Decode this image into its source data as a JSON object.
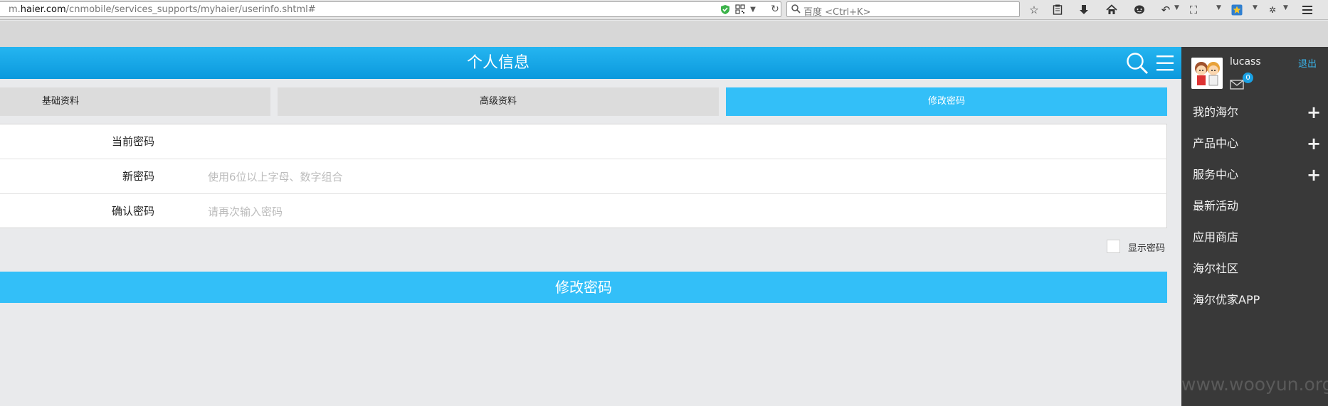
{
  "browser": {
    "url_prefix": "m.",
    "url_domain": "haier.com",
    "url_path": "/cnmobile/services_supports/myhaier/userinfo.shtml#",
    "search_placeholder": "百度 <Ctrl+K>"
  },
  "header": {
    "title": "个人信息"
  },
  "tabs": [
    {
      "label": "基础资料",
      "active": false
    },
    {
      "label": "高级资料",
      "active": false
    },
    {
      "label": "修改密码",
      "active": true
    }
  ],
  "form": {
    "current_password": {
      "label": "当前密码",
      "placeholder": ""
    },
    "new_password": {
      "label": "新密码",
      "placeholder": "使用6位以上字母、数字组合"
    },
    "confirm_password": {
      "label": "确认密码",
      "placeholder": "请再次输入密码"
    },
    "show_password_label": "显示密码",
    "submit_label": "修改密码"
  },
  "side_menu": {
    "username": "lucass",
    "logout_label": "退出",
    "mail_count": "0",
    "items": [
      {
        "label": "我的海尔",
        "expandable": true
      },
      {
        "label": "产品中心",
        "expandable": true
      },
      {
        "label": "服务中心",
        "expandable": true
      },
      {
        "label": "最新活动",
        "expandable": false
      },
      {
        "label": "应用商店",
        "expandable": false
      },
      {
        "label": "海尔社区",
        "expandable": false
      },
      {
        "label": "海尔优家APP",
        "expandable": false
      }
    ]
  },
  "watermark": "www.wooyun.org",
  "colors": {
    "accent": "#33bff8",
    "header": "#0b99dd",
    "side_bg": "#393939",
    "page_bg": "#e9eaec"
  }
}
